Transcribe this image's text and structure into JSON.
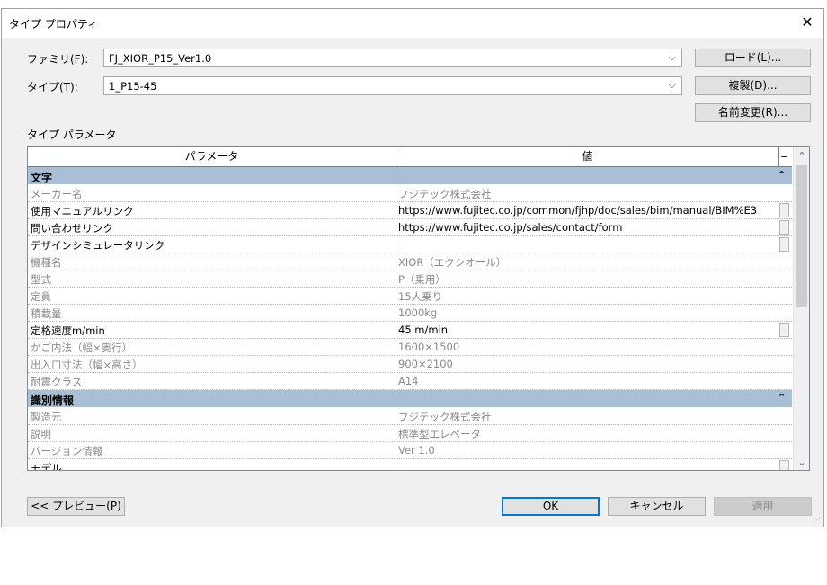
{
  "window": {
    "title": "タイプ プロパティ",
    "close_glyph": "✕"
  },
  "family": {
    "label": "ファミリ(F):",
    "value": "FJ_XIOR_P15_Ver1.0"
  },
  "type": {
    "label": "タイプ(T):",
    "value": "1_P15-45"
  },
  "buttons": {
    "load": "ロード(L)...",
    "duplicate": "複製(D)...",
    "rename": "名前変更(R)...",
    "preview": "<< プレビュー(P)",
    "ok": "OK",
    "cancel": "キャンセル",
    "apply": "適用"
  },
  "params_title": "タイプ パラメータ",
  "table": {
    "col_param": "パラメータ",
    "col_value": "値",
    "eq": "=",
    "groups": [
      {
        "name": "文字",
        "collapse": "⌃",
        "rows": [
          {
            "p": "メーカー名",
            "v": "フジテック株式会社",
            "editable": false
          },
          {
            "p": "使用マニュアルリンク",
            "v": "https://www.fujitec.co.jp/common/fjhp/doc/sales/bim/manual/BIM%E3",
            "editable": true
          },
          {
            "p": "問い合わせリンク",
            "v": "https://www.fujitec.co.jp/sales/contact/form",
            "editable": true
          },
          {
            "p": "デザインシミュレータリンク",
            "v": "",
            "editable": true
          },
          {
            "p": "機種名",
            "v": "XIOR（エクシオール）",
            "editable": false
          },
          {
            "p": "型式",
            "v": "P（乗用）",
            "editable": false
          },
          {
            "p": "定員",
            "v": "15人乗り",
            "editable": false
          },
          {
            "p": "積載量",
            "v": "1000kg",
            "editable": false
          },
          {
            "p": "定格速度m/min",
            "v": "45 m/min",
            "editable": true
          },
          {
            "p": "かご内法（幅×奥行）",
            "v": "1600×1500",
            "editable": false
          },
          {
            "p": "出入口寸法（幅×高さ）",
            "v": "900×2100",
            "editable": false
          },
          {
            "p": "耐震クラス",
            "v": "A14",
            "editable": false
          }
        ]
      },
      {
        "name": "識別情報",
        "collapse": "⌃",
        "rows": [
          {
            "p": "製造元",
            "v": "フジテック株式会社",
            "editable": false
          },
          {
            "p": "説明",
            "v": "標準型エレベータ",
            "editable": false
          },
          {
            "p": "バージョン情報",
            "v": "Ver 1.0",
            "editable": false
          },
          {
            "p": "モデル",
            "v": "",
            "editable": true
          }
        ]
      }
    ]
  },
  "icons": {
    "combo_arrow": "chevron-down-icon",
    "scroll_up": "scroll-up-icon",
    "scroll_down": "scroll-down-icon"
  }
}
